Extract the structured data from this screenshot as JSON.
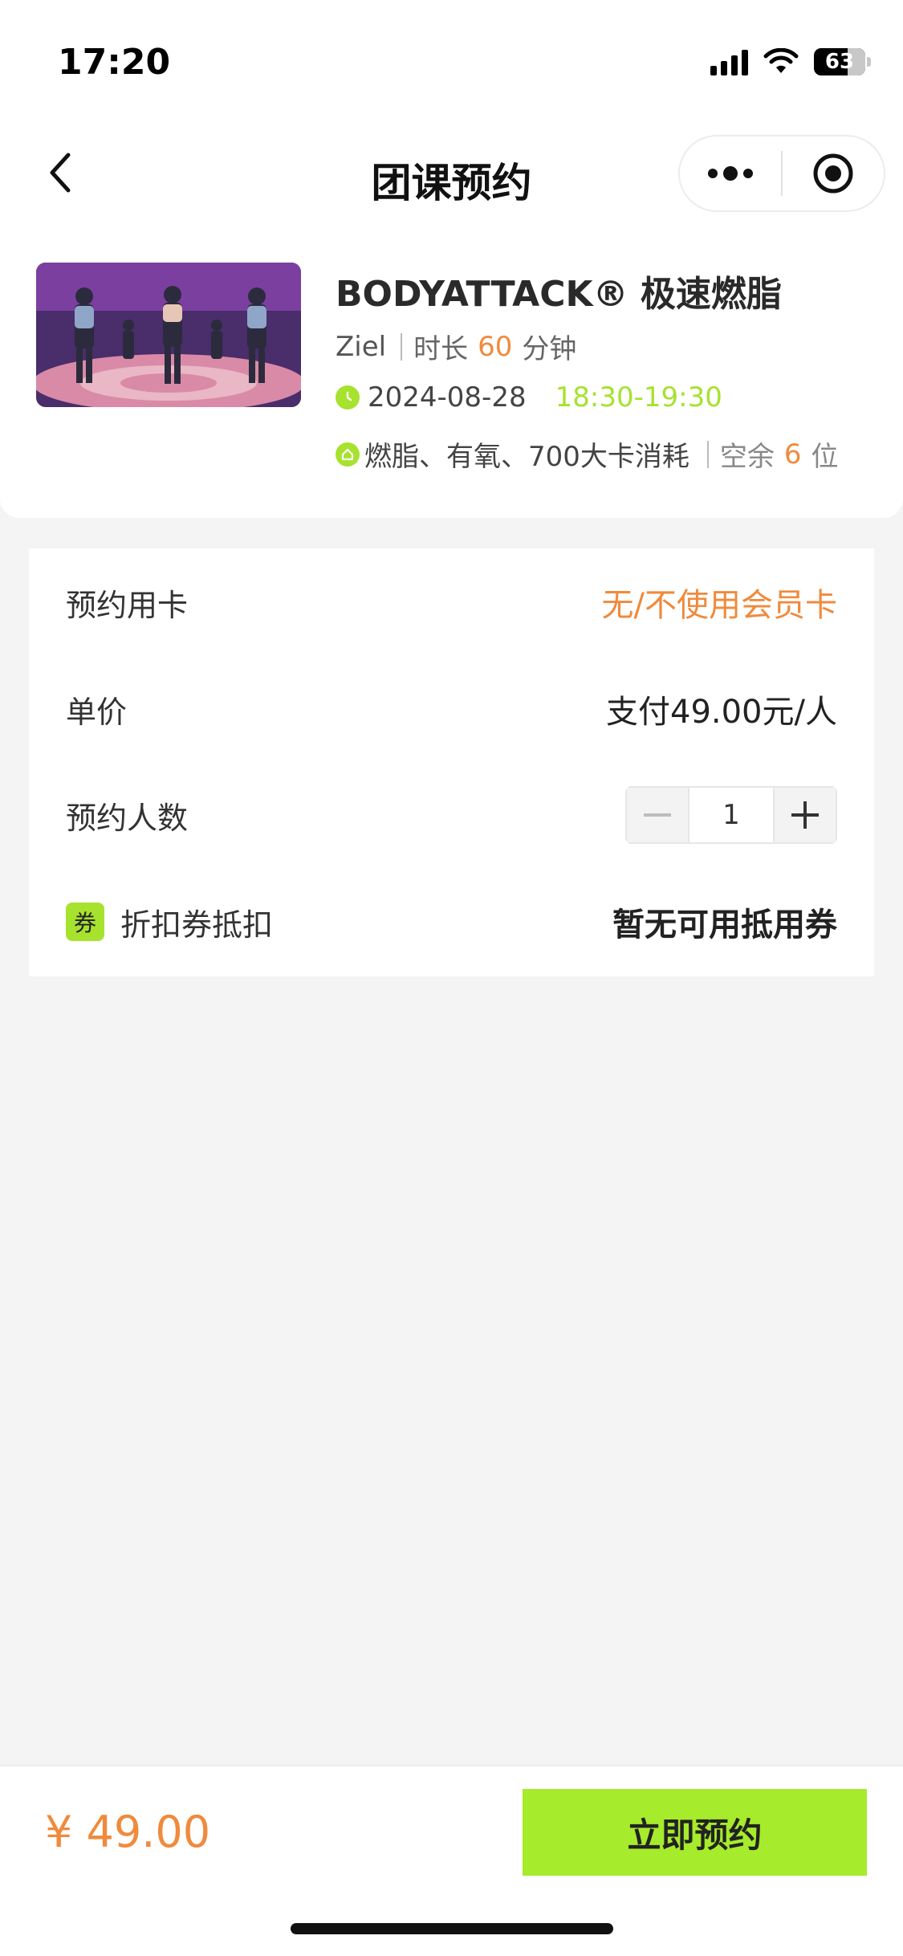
{
  "status_bar": {
    "time": "17:20",
    "battery_level": "63",
    "icons": [
      "signal-icon",
      "wifi-icon",
      "battery-icon"
    ]
  },
  "nav": {
    "title": "团课预约",
    "back_icon": "chevron-left-icon",
    "more_icon": "more-dots-icon",
    "close_icon": "target-circle-icon"
  },
  "course": {
    "title": "BODYATTACK® 极速燃脂",
    "coach": "Ziel",
    "duration_prefix": "时长",
    "duration_value": "60",
    "duration_unit": "分钟",
    "date": "2024-08-28",
    "time_range": "18:30-19:30",
    "tags": "燃脂、有氧、700大卡消耗",
    "spots_prefix": "空余",
    "spots_value": "6",
    "spots_unit": "位"
  },
  "booking": {
    "card_label": "预约用卡",
    "card_value": "无/不使用会员卡",
    "price_label": "单价",
    "price_value": "支付49.00元/人",
    "count_label": "预约人数",
    "count_value": "1",
    "coupon_badge": "券",
    "coupon_label": "折扣券抵扣",
    "coupon_value": "暂无可用抵用券"
  },
  "footer": {
    "total_price": "¥ 49.00",
    "book_button": "立即预约"
  },
  "colors": {
    "accent_green": "#a6e22e",
    "accent_orange": "#f08a3c",
    "background": "#f4f4f4"
  }
}
